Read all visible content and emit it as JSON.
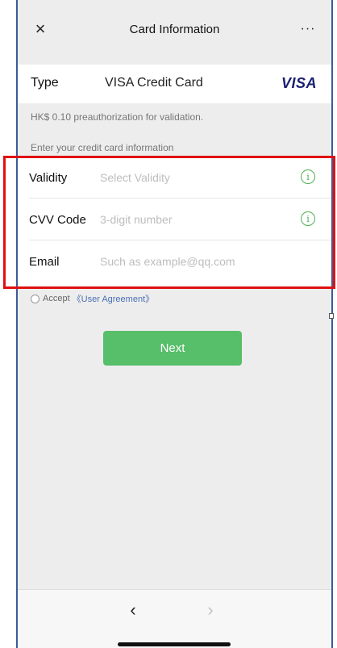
{
  "navbar": {
    "close_icon": "×",
    "title": "Card Information",
    "more_icon": "···"
  },
  "type_row": {
    "label": "Type",
    "value": "VISA Credit Card",
    "logo_text": "VISA"
  },
  "notes": {
    "preauth": "HK$ 0.10 preauthorization for validation.",
    "enter_info": "Enter your credit card information"
  },
  "form": {
    "validity": {
      "label": "Validity",
      "placeholder": "Select Validity",
      "value": ""
    },
    "cvv": {
      "label": "CVV Code",
      "placeholder": "3-digit number",
      "value": ""
    },
    "email": {
      "label": "Email",
      "placeholder": "Such as example@qq.com",
      "value": ""
    },
    "info_icon": "i"
  },
  "accept": {
    "label": "Accept",
    "link": "《User Agreement》"
  },
  "next_button": "Next",
  "toolbar": {
    "back": "‹",
    "forward": "›"
  },
  "colors": {
    "accent_green": "#57be6a",
    "highlight_red": "#e01010",
    "visa_blue": "#1a1f71",
    "link_blue": "#4a6fb5"
  }
}
